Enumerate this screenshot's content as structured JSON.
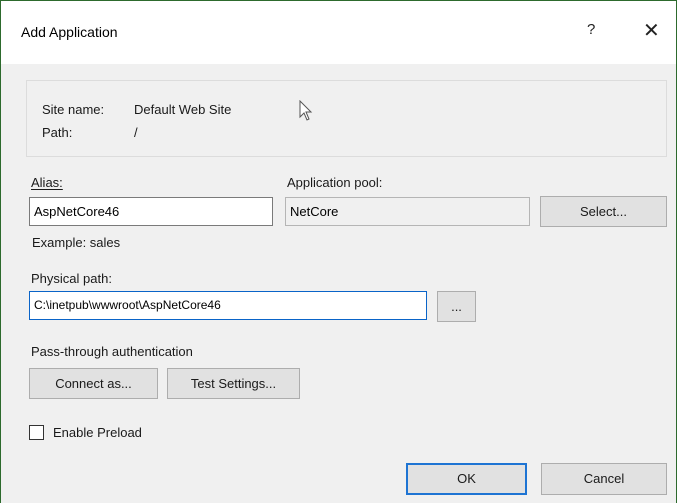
{
  "dialog": {
    "title": "Add Application",
    "help_glyph": "?",
    "close_glyph": "✕"
  },
  "site": {
    "site_name_label": "Site name:",
    "site_name_value": "Default Web Site",
    "path_label": "Path:",
    "path_value": "/"
  },
  "alias": {
    "label": "Alias:",
    "value": "AspNetCore46",
    "example": "Example: sales"
  },
  "app_pool": {
    "label": "Application pool:",
    "value": "NetCore",
    "select_button": "Select..."
  },
  "physical_path": {
    "label": "Physical path:",
    "value": "C:\\inetpub\\wwwroot\\AspNetCore46",
    "browse_button": "..."
  },
  "auth": {
    "label": "Pass-through authentication",
    "connect_as_button": "Connect as...",
    "test_settings_button": "Test Settings..."
  },
  "preload": {
    "label": "Enable Preload",
    "checked": false
  },
  "footer": {
    "ok_button": "OK",
    "cancel_button": "Cancel"
  },
  "colors": {
    "window_border": "#2d6a2d",
    "focus_border": "#1e74d3",
    "dialog_bg": "#f0f0f0"
  }
}
